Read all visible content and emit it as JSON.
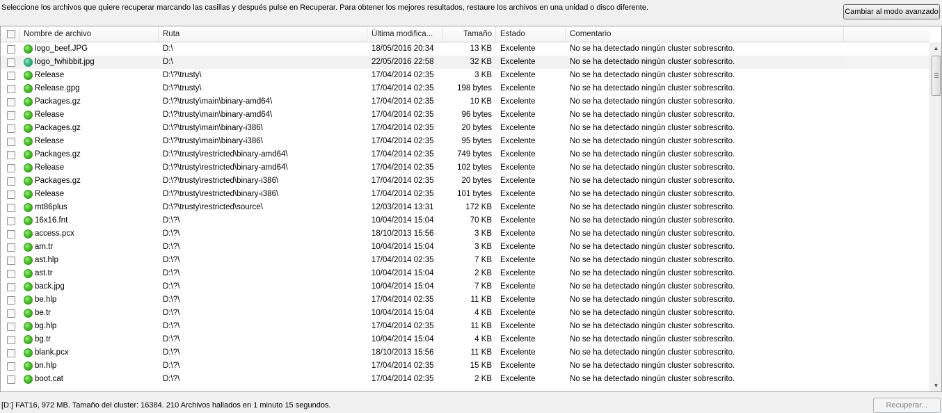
{
  "instructions": "Seleccione los archivos que quiere recuperar marcando las casillas y después pulse en Recuperar. Para obtener los mejores resultados, restaure los archivos en una unidad o disco diferente.",
  "advanced_button": "Cambiar al modo avanzado",
  "columns": {
    "name": "Nombre de archivo",
    "path": "Ruta",
    "date": "Última modifica...",
    "size": "Tamaño",
    "state": "Estado",
    "comment": "Comentario"
  },
  "rows": [
    {
      "name": "logo_beef.JPG",
      "path": "D:\\",
      "date": "18/05/2016 20:34",
      "size": "13 KB",
      "state": "Excelente",
      "comment": "No se ha detectado ningún cluster sobrescrito."
    },
    {
      "name": "logo_fwhibbit.jpg",
      "path": "D:\\",
      "date": "22/05/2016 22:58",
      "size": "32 KB",
      "state": "Excelente",
      "comment": "No se ha detectado ningún cluster sobrescrito."
    },
    {
      "name": "Release",
      "path": "D:\\?\\trusty\\",
      "date": "17/04/2014 02:35",
      "size": "3 KB",
      "state": "Excelente",
      "comment": "No se ha detectado ningún cluster sobrescrito."
    },
    {
      "name": "Release.gpg",
      "path": "D:\\?\\trusty\\",
      "date": "17/04/2014 02:35",
      "size": "198 bytes",
      "state": "Excelente",
      "comment": "No se ha detectado ningún cluster sobrescrito."
    },
    {
      "name": "Packages.gz",
      "path": "D:\\?\\trusty\\main\\binary-amd64\\",
      "date": "17/04/2014 02:35",
      "size": "10 KB",
      "state": "Excelente",
      "comment": "No se ha detectado ningún cluster sobrescrito."
    },
    {
      "name": "Release",
      "path": "D:\\?\\trusty\\main\\binary-amd64\\",
      "date": "17/04/2014 02:35",
      "size": "96 bytes",
      "state": "Excelente",
      "comment": "No se ha detectado ningún cluster sobrescrito."
    },
    {
      "name": "Packages.gz",
      "path": "D:\\?\\trusty\\main\\binary-i386\\",
      "date": "17/04/2014 02:35",
      "size": "20 bytes",
      "state": "Excelente",
      "comment": "No se ha detectado ningún cluster sobrescrito."
    },
    {
      "name": "Release",
      "path": "D:\\?\\trusty\\main\\binary-i386\\",
      "date": "17/04/2014 02:35",
      "size": "95 bytes",
      "state": "Excelente",
      "comment": "No se ha detectado ningún cluster sobrescrito."
    },
    {
      "name": "Packages.gz",
      "path": "D:\\?\\trusty\\restricted\\binary-amd64\\",
      "date": "17/04/2014 02:35",
      "size": "749 bytes",
      "state": "Excelente",
      "comment": "No se ha detectado ningún cluster sobrescrito."
    },
    {
      "name": "Release",
      "path": "D:\\?\\trusty\\restricted\\binary-amd64\\",
      "date": "17/04/2014 02:35",
      "size": "102 bytes",
      "state": "Excelente",
      "comment": "No se ha detectado ningún cluster sobrescrito."
    },
    {
      "name": "Packages.gz",
      "path": "D:\\?\\trusty\\restricted\\binary-i386\\",
      "date": "17/04/2014 02:35",
      "size": "20 bytes",
      "state": "Excelente",
      "comment": "No se ha detectado ningún cluster sobrescrito."
    },
    {
      "name": "Release",
      "path": "D:\\?\\trusty\\restricted\\binary-i386\\",
      "date": "17/04/2014 02:35",
      "size": "101 bytes",
      "state": "Excelente",
      "comment": "No se ha detectado ningún cluster sobrescrito."
    },
    {
      "name": "mt86plus",
      "path": "D:\\?\\trusty\\restricted\\source\\",
      "date": "12/03/2014 13:31",
      "size": "172 KB",
      "state": "Excelente",
      "comment": "No se ha detectado ningún cluster sobrescrito."
    },
    {
      "name": "16x16.fnt",
      "path": "D:\\?\\",
      "date": "10/04/2014 15:04",
      "size": "70 KB",
      "state": "Excelente",
      "comment": "No se ha detectado ningún cluster sobrescrito."
    },
    {
      "name": "access.pcx",
      "path": "D:\\?\\",
      "date": "18/10/2013 15:56",
      "size": "3 KB",
      "state": "Excelente",
      "comment": "No se ha detectado ningún cluster sobrescrito."
    },
    {
      "name": "am.tr",
      "path": "D:\\?\\",
      "date": "10/04/2014 15:04",
      "size": "3 KB",
      "state": "Excelente",
      "comment": "No se ha detectado ningún cluster sobrescrito."
    },
    {
      "name": "ast.hlp",
      "path": "D:\\?\\",
      "date": "17/04/2014 02:35",
      "size": "7 KB",
      "state": "Excelente",
      "comment": "No se ha detectado ningún cluster sobrescrito."
    },
    {
      "name": "ast.tr",
      "path": "D:\\?\\",
      "date": "10/04/2014 15:04",
      "size": "2 KB",
      "state": "Excelente",
      "comment": "No se ha detectado ningún cluster sobrescrito."
    },
    {
      "name": "back.jpg",
      "path": "D:\\?\\",
      "date": "10/04/2014 15:04",
      "size": "7 KB",
      "state": "Excelente",
      "comment": "No se ha detectado ningún cluster sobrescrito."
    },
    {
      "name": "be.hlp",
      "path": "D:\\?\\",
      "date": "17/04/2014 02:35",
      "size": "11 KB",
      "state": "Excelente",
      "comment": "No se ha detectado ningún cluster sobrescrito."
    },
    {
      "name": "be.tr",
      "path": "D:\\?\\",
      "date": "10/04/2014 15:04",
      "size": "4 KB",
      "state": "Excelente",
      "comment": "No se ha detectado ningún cluster sobrescrito."
    },
    {
      "name": "bg.hlp",
      "path": "D:\\?\\",
      "date": "17/04/2014 02:35",
      "size": "11 KB",
      "state": "Excelente",
      "comment": "No se ha detectado ningún cluster sobrescrito."
    },
    {
      "name": "bg.tr",
      "path": "D:\\?\\",
      "date": "10/04/2014 15:04",
      "size": "4 KB",
      "state": "Excelente",
      "comment": "No se ha detectado ningún cluster sobrescrito."
    },
    {
      "name": "blank.pcx",
      "path": "D:\\?\\",
      "date": "18/10/2013 15:56",
      "size": "11 KB",
      "state": "Excelente",
      "comment": "No se ha detectado ningún cluster sobrescrito."
    },
    {
      "name": "bn.hlp",
      "path": "D:\\?\\",
      "date": "17/04/2014 02:35",
      "size": "15 KB",
      "state": "Excelente",
      "comment": "No se ha detectado ningún cluster sobrescrito."
    },
    {
      "name": "boot.cat",
      "path": "D:\\?\\",
      "date": "17/04/2014 02:35",
      "size": "2 KB",
      "state": "Excelente",
      "comment": "No se ha detectado ningún cluster sobrescrito."
    }
  ],
  "hover_row_index": 1,
  "status_text": "[D:] FAT16, 972 MB. Tamaño del cluster: 16384. 210 Archivos hallados en 1 minuto 15 segundos.",
  "recover_button": "Recuperar...",
  "colors": {
    "status_ok": "#4cc22c",
    "status_ok_alt": "#3fb889"
  }
}
